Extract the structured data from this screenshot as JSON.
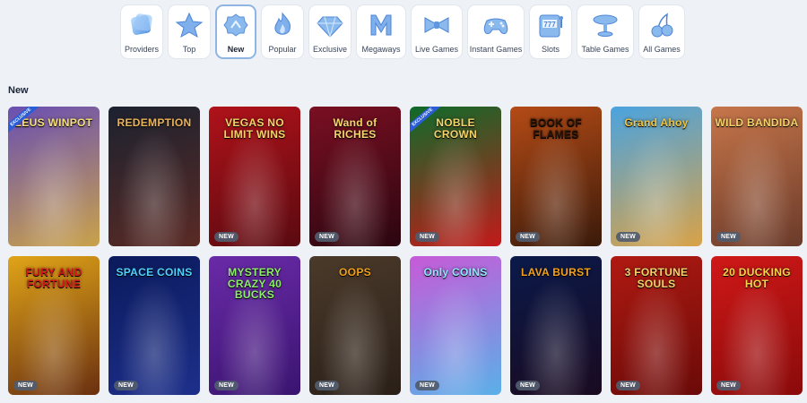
{
  "categories": [
    {
      "label": "Providers",
      "icon": "providers-icon",
      "width": 48
    },
    {
      "label": "Top",
      "icon": "star-icon",
      "width": 48
    },
    {
      "label": "New",
      "icon": "new-badge-icon",
      "width": 46,
      "active": true
    },
    {
      "label": "Popular",
      "icon": "flame-icon",
      "width": 48
    },
    {
      "label": "Exclusive",
      "icon": "diamond-icon",
      "width": 48
    },
    {
      "label": "Megaways",
      "icon": "megaways-icon",
      "width": 56
    },
    {
      "label": "Live Games",
      "icon": "bowtie-icon",
      "width": 58
    },
    {
      "label": "Instant Games",
      "icon": "gamepad-icon",
      "width": 64
    },
    {
      "label": "Slots",
      "icon": "slot-machine-icon",
      "width": 48
    },
    {
      "label": "Table Games",
      "icon": "table-icon",
      "width": 64
    },
    {
      "label": "All Games",
      "icon": "cherries-icon",
      "width": 52
    }
  ],
  "section": {
    "title": "New"
  },
  "badge_label": "NEW",
  "exclusive_label": "EXCLUSIVE",
  "games": [
    {
      "title": "ZEUS WINPOT",
      "bg": [
        "#6a4fb3",
        "#c9a24a"
      ],
      "title_color": "#f7e07a",
      "new": false,
      "exclusive": true
    },
    {
      "title": "REDEMPTION",
      "bg": [
        "#1c2230",
        "#5a2a24"
      ],
      "title_color": "#e9b35a",
      "new": false
    },
    {
      "title": "VEGAS NO LIMIT WINS",
      "bg": [
        "#b0121a",
        "#5a0a10"
      ],
      "title_color": "#f4d36a",
      "new": true
    },
    {
      "title": "Wand of RICHES",
      "bg": [
        "#7a0f22",
        "#2b0610"
      ],
      "title_color": "#f5d76e",
      "new": true
    },
    {
      "title": "NOBLE CROWN",
      "bg": [
        "#0f6b2a",
        "#c21a1a"
      ],
      "title_color": "#f4d36a",
      "new": true,
      "exclusive": true
    },
    {
      "title": "BOOK OF FLAMES",
      "bg": [
        "#b54b16",
        "#3a1a0a"
      ],
      "title_color": "#2a1406",
      "new": true
    },
    {
      "title": "Grand Ahoy",
      "bg": [
        "#4aa3e0",
        "#d9a247"
      ],
      "title_color": "#f4c53a",
      "new": true
    },
    {
      "title": "WILD BANDIDA",
      "bg": [
        "#c7764a",
        "#6a3a2a"
      ],
      "title_color": "#f4d36a",
      "new": true
    },
    {
      "title": "FURY AND FORTUNE",
      "bg": [
        "#e0a418",
        "#6a3010"
      ],
      "title_color": "#d41a1a",
      "new": true
    },
    {
      "title": "SPACE COINS",
      "bg": [
        "#0b1a5c",
        "#1d2f8a"
      ],
      "title_color": "#4fd2ff",
      "new": true
    },
    {
      "title": "MYSTERY CRAZY 40 BUCKS",
      "bg": [
        "#6a2aa8",
        "#3a1470"
      ],
      "title_color": "#8df06a",
      "new": true
    },
    {
      "title": "OOPS",
      "bg": [
        "#4a3a2a",
        "#2a1f18"
      ],
      "title_color": "#f0a018",
      "new": true
    },
    {
      "title": "Only COINS",
      "bg": [
        "#c75ad8",
        "#5ab0e8"
      ],
      "title_color": "#8fe8ff",
      "new": true
    },
    {
      "title": "LAVA BURST",
      "bg": [
        "#0a1a4a",
        "#1a0a20"
      ],
      "title_color": "#f5a018",
      "new": true
    },
    {
      "title": "3 FORTUNE SOULS",
      "bg": [
        "#b01a12",
        "#6a0a08"
      ],
      "title_color": "#f4d36a",
      "new": true
    },
    {
      "title": "20 DUCKING HOT",
      "bg": [
        "#d01818",
        "#8a0a0a"
      ],
      "title_color": "#ffd44a",
      "new": true
    }
  ]
}
